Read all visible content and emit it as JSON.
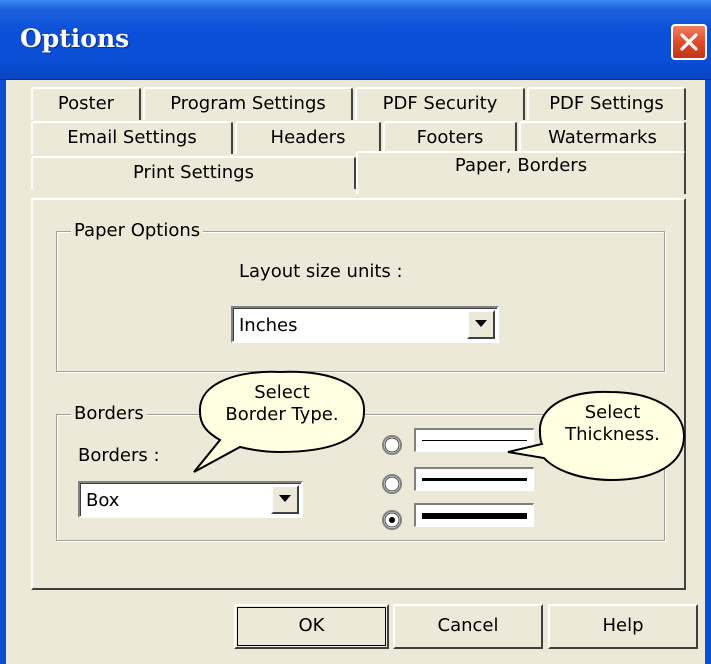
{
  "window": {
    "title": "Options"
  },
  "tabs": {
    "row1": [
      "Poster",
      "Program Settings",
      "PDF Security",
      "PDF Settings"
    ],
    "row2": [
      "Email Settings",
      "Headers",
      "Footers",
      "Watermarks"
    ],
    "row3": [
      "Print Settings",
      "Paper, Borders"
    ],
    "active": "Paper, Borders"
  },
  "paper_options": {
    "group_label": "Paper Options",
    "units_label": "Layout size units :",
    "units_value": "Inches"
  },
  "borders": {
    "group_label": "Borders",
    "borders_label": "Borders :",
    "borders_value": "Box",
    "thickness_selected_index": 2
  },
  "callouts": {
    "border_type": [
      "Select",
      "Border Type."
    ],
    "thickness": [
      "Select",
      "Thickness."
    ]
  },
  "buttons": {
    "ok": "OK",
    "cancel": "Cancel",
    "help": "Help"
  },
  "colors": {
    "titlebar": "#0a4fd6",
    "close": "#e04b2a",
    "dialog_bg": "#ece9d8",
    "callout_fill": "#ffffe1"
  }
}
